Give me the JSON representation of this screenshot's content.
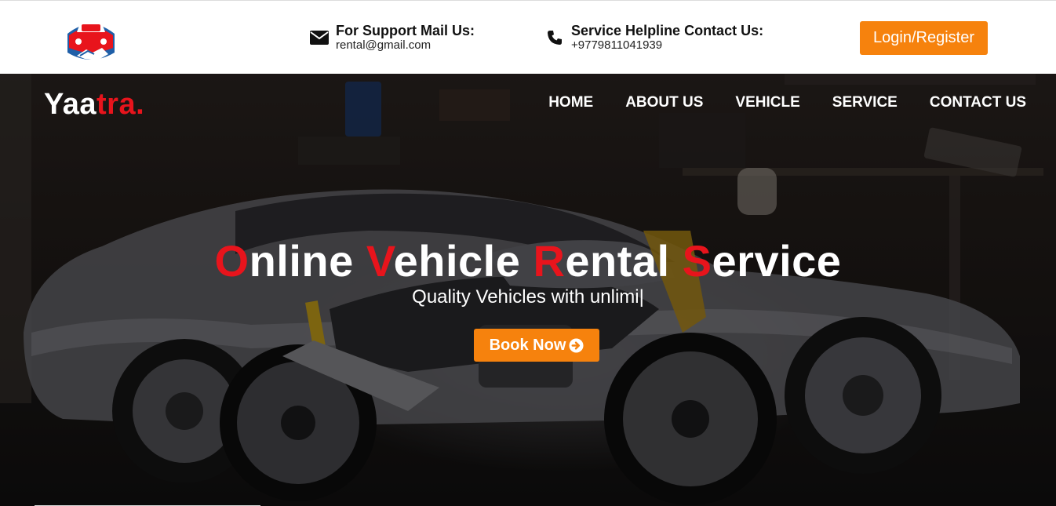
{
  "support": {
    "title": "For Support Mail Us:",
    "email": "rental@gmail.com"
  },
  "helpline": {
    "title": "Service Helpline Contact Us:",
    "phone": "+9779811041939"
  },
  "login_label": "Login/Register",
  "brand": {
    "part1": "Yaa",
    "part2": "tra."
  },
  "nav": [
    "HOME",
    "ABOUT US",
    "VEHICLE",
    "SERVICE",
    "CONTACT US"
  ],
  "hero": {
    "words": [
      {
        "cap": "O",
        "rest": "nline"
      },
      {
        "cap": "V",
        "rest": "ehicle"
      },
      {
        "cap": "R",
        "rest": "ental"
      },
      {
        "cap": "S",
        "rest": "ervice"
      }
    ],
    "subtitle": "Quality Vehicles with unlimi",
    "cursor": "|",
    "book_label": "Book Now"
  },
  "colors": {
    "accent": "#f6820d",
    "brand_red": "#e8141c",
    "logo_blue": "#1f5fa8"
  },
  "icons": {
    "mail": "envelope-icon",
    "phone": "phone-icon",
    "book": "arrow-circle-right-icon"
  }
}
